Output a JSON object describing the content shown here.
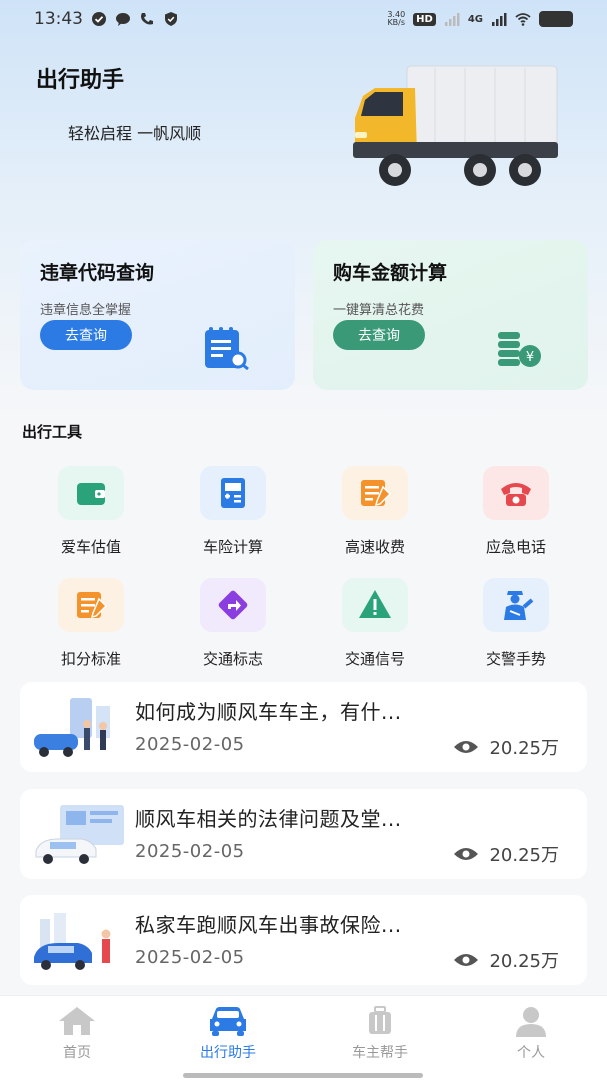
{
  "status": {
    "time": "13:43",
    "speed_top": "3.40",
    "speed_unit": "KB/s",
    "hd": "HD",
    "sig": "4G"
  },
  "header": {
    "title": "出行助手",
    "slogan": "轻松启程 一帆风顺"
  },
  "cards": [
    {
      "title": "违章代码查询",
      "subtitle": "违章信息全掌握",
      "button": "去查询"
    },
    {
      "title": "购车金额计算",
      "subtitle": "一键算清总花费",
      "button": "去查询"
    }
  ],
  "tools_section": {
    "title": "出行工具",
    "items": [
      {
        "label": "爱车估值",
        "icon": "wallet-icon"
      },
      {
        "label": "车险计算",
        "icon": "calculator-icon"
      },
      {
        "label": "高速收费",
        "icon": "note-pen-icon"
      },
      {
        "label": "应急电话",
        "icon": "phone-icon"
      },
      {
        "label": "扣分标准",
        "icon": "note-pen-icon"
      },
      {
        "label": "交通标志",
        "icon": "direction-sign-icon"
      },
      {
        "label": "交通信号",
        "icon": "warning-icon"
      },
      {
        "label": "交警手势",
        "icon": "police-icon"
      }
    ]
  },
  "articles": [
    {
      "title": "如何成为顺风车车主，有什...",
      "date": "2025-02-05",
      "views": "20.25万"
    },
    {
      "title": "顺风车相关的法律问题及堂...",
      "date": "2025-02-05",
      "views": "20.25万"
    },
    {
      "title": "私家车跑顺风车出事故保险...",
      "date": "2025-02-05",
      "views": "20.25万"
    }
  ],
  "nav": {
    "items": [
      {
        "label": "首页",
        "icon": "home-icon"
      },
      {
        "label": "出行助手",
        "icon": "car-icon"
      },
      {
        "label": "车主帮手",
        "icon": "luggage-icon"
      },
      {
        "label": "个人",
        "icon": "user-icon"
      }
    ],
    "active_index": 1
  },
  "colors": {
    "accent": "#2c7be5",
    "green": "#3a9a77"
  }
}
